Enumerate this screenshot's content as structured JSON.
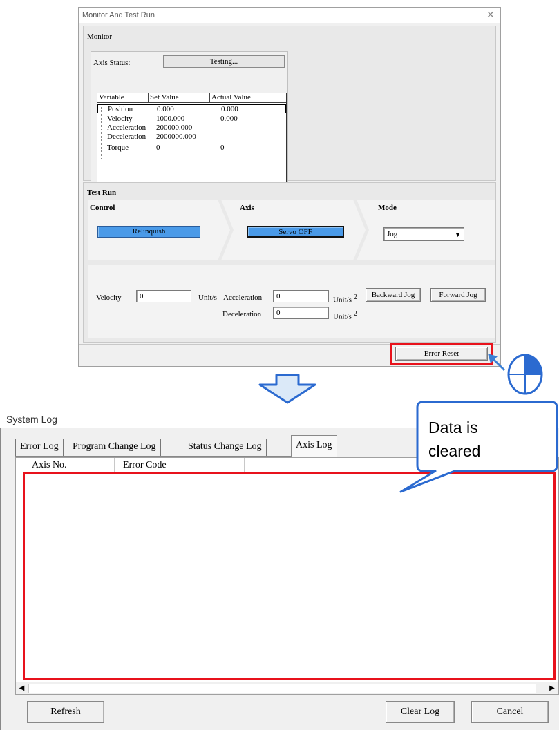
{
  "monitor_dialog": {
    "title": "Monitor And Test Run",
    "close_glyph": "✕",
    "monitor_group": {
      "title": "Monitor",
      "axis_status_label": "Axis Status:",
      "axis_status_value": "Testing...",
      "variable_table": {
        "headers": [
          "Variable",
          "Set Value",
          "Actual Value"
        ],
        "rows": [
          {
            "variable": "Position",
            "set_value": "0.000",
            "actual_value": "0.000"
          },
          {
            "variable": "Velocity",
            "set_value": "1000.000",
            "actual_value": "0.000"
          },
          {
            "variable": "Acceleration",
            "set_value": "200000.000",
            "actual_value": ""
          },
          {
            "variable": "Deceleration",
            "set_value": "2000000.000",
            "actual_value": ""
          },
          {
            "variable": "Torque",
            "set_value": "0",
            "actual_value": "0"
          }
        ]
      }
    },
    "test_run_group": {
      "title": "Test Run",
      "control_label": "Control",
      "axis_label": "Axis",
      "mode_label": "Mode",
      "relinquish_button": "Relinquish",
      "servo_button": "Servo OFF",
      "mode_selected": "Jog",
      "velocity_label": "Velocity",
      "velocity_value": "0",
      "velocity_unit": "Unit/s",
      "acceleration_label": "Acceleration",
      "acceleration_value": "0",
      "acceleration_unit": "Unit/s",
      "acceleration_unit_sup": "2",
      "deceleration_label": "Deceleration",
      "deceleration_value": "0",
      "deceleration_unit": "Unit/s",
      "deceleration_unit_sup": "2",
      "backward_jog_button": "Backward Jog",
      "forward_jog_button": "Forward Jog"
    },
    "error_reset_button": "Error Reset"
  },
  "system_log": {
    "title": "System Log",
    "tabs": [
      "Error Log",
      "Program Change Log",
      "Status Change Log",
      "Axis Log"
    ],
    "active_tab": "Axis Log",
    "columns": [
      "Axis No.",
      "Error Code"
    ],
    "rows": [],
    "refresh_button": "Refresh",
    "clear_log_button": "Clear Log",
    "cancel_button": "Cancel"
  },
  "callout": {
    "text_line1": "Data is",
    "text_line2": "cleared"
  },
  "colors": {
    "highlight_red": "#e8121c",
    "accent_blue": "#3a7fd5",
    "button_blue": "#4a9ae8"
  },
  "icons": {
    "arrow_down": "down-arrow-icon",
    "mouse_click": "mouse-click-icon"
  }
}
